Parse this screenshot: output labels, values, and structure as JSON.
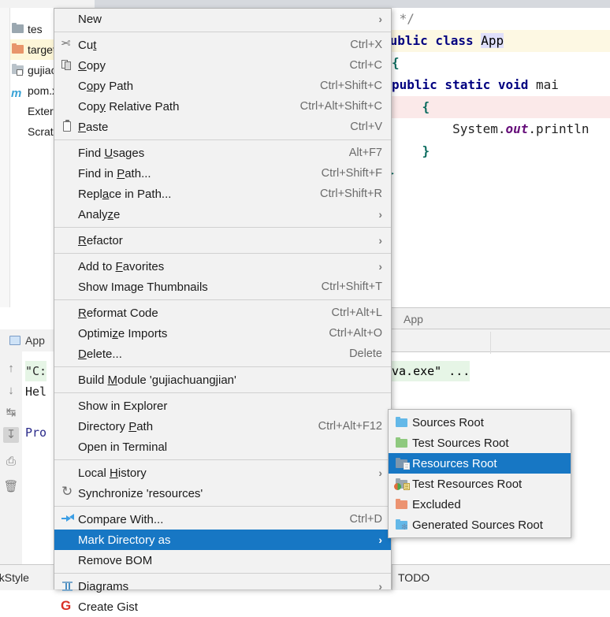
{
  "ide": {
    "project_tree": [
      {
        "label": "tes",
        "icon": "folder-icon",
        "color": "#9aa7b0",
        "twisty": "›",
        "highlight": false
      },
      {
        "label": "target",
        "icon": "folder-excluded-icon",
        "color": "#e8956a",
        "twisty": "",
        "highlight": true
      },
      {
        "label": "gujiac",
        "icon": "module-icon",
        "color": "#b9c2c9",
        "twisty": "",
        "highlight": false
      },
      {
        "label": "pom.x",
        "icon": "maven-icon",
        "color": "#3aa3d6",
        "twisty": "",
        "highlight": false
      },
      {
        "label": "External L",
        "icon": "library-icon",
        "color": "",
        "twisty": "",
        "highlight": false
      },
      {
        "label": "Scratches",
        "icon": "scratches-icon",
        "color": "",
        "twisty": "",
        "highlight": false
      }
    ],
    "editor": {
      "lines": [
        {
          "text": "*/",
          "cls": "cm"
        },
        {
          "text": "public class App",
          "cls": "code"
        },
        {
          "text": "{",
          "cls": "code"
        },
        {
          "text": "    public static void mai",
          "cls": "code"
        },
        {
          "text": "    {",
          "cls": "code"
        },
        {
          "text": "        System.out.println",
          "cls": "code"
        },
        {
          "text": "    }",
          "cls": "code"
        },
        {
          "text": "}",
          "cls": "code"
        }
      ],
      "breadcrumb": "App"
    },
    "run_panel": {
      "tab_label": "App",
      "lines": [
        "\"C:",
        "Hel",
        "",
        "Pro"
      ],
      "lines_right": "va.exe\" ..."
    },
    "status_bar": {
      "left": "eckStyle",
      "right": "TODO"
    }
  },
  "context_menu": {
    "items": [
      {
        "label": "New",
        "mnemonic": "",
        "shortcut": "",
        "arrow": true,
        "icon": "",
        "sep_after": true,
        "selected": false
      },
      {
        "label": "Cut",
        "mnemonic": "t",
        "shortcut": "Ctrl+X",
        "arrow": false,
        "icon": "scissors-icon",
        "sep_after": false,
        "selected": false
      },
      {
        "label": "Copy",
        "mnemonic": "C",
        "shortcut": "Ctrl+C",
        "arrow": false,
        "icon": "copy-icon",
        "sep_after": false,
        "selected": false
      },
      {
        "label": "Copy Path",
        "mnemonic": "o",
        "shortcut": "Ctrl+Shift+C",
        "arrow": false,
        "icon": "",
        "sep_after": false,
        "selected": false
      },
      {
        "label": "Copy Relative Path",
        "mnemonic": "y",
        "shortcut": "Ctrl+Alt+Shift+C",
        "arrow": false,
        "icon": "",
        "sep_after": false,
        "selected": false
      },
      {
        "label": "Paste",
        "mnemonic": "P",
        "shortcut": "Ctrl+V",
        "arrow": false,
        "icon": "paste-icon",
        "sep_after": true,
        "selected": false
      },
      {
        "label": "Find Usages",
        "mnemonic": "U",
        "shortcut": "Alt+F7",
        "arrow": false,
        "icon": "",
        "sep_after": false,
        "selected": false
      },
      {
        "label": "Find in Path...",
        "mnemonic": "P",
        "shortcut": "Ctrl+Shift+F",
        "arrow": false,
        "icon": "",
        "sep_after": false,
        "selected": false
      },
      {
        "label": "Replace in Path...",
        "mnemonic": "a",
        "shortcut": "Ctrl+Shift+R",
        "arrow": false,
        "icon": "",
        "sep_after": false,
        "selected": false
      },
      {
        "label": "Analyze",
        "mnemonic": "z",
        "shortcut": "",
        "arrow": true,
        "icon": "",
        "sep_after": true,
        "selected": false
      },
      {
        "label": "Refactor",
        "mnemonic": "R",
        "shortcut": "",
        "arrow": true,
        "icon": "",
        "sep_after": true,
        "selected": false
      },
      {
        "label": "Add to Favorites",
        "mnemonic": "F",
        "shortcut": "",
        "arrow": true,
        "icon": "",
        "sep_after": false,
        "selected": false
      },
      {
        "label": "Show Image Thumbnails",
        "mnemonic": "",
        "shortcut": "Ctrl+Shift+T",
        "arrow": false,
        "icon": "",
        "sep_after": true,
        "selected": false
      },
      {
        "label": "Reformat Code",
        "mnemonic": "R",
        "shortcut": "Ctrl+Alt+L",
        "arrow": false,
        "icon": "",
        "sep_after": false,
        "selected": false
      },
      {
        "label": "Optimize Imports",
        "mnemonic": "z",
        "shortcut": "Ctrl+Alt+O",
        "arrow": false,
        "icon": "",
        "sep_after": false,
        "selected": false
      },
      {
        "label": "Delete...",
        "mnemonic": "D",
        "shortcut": "Delete",
        "arrow": false,
        "icon": "",
        "sep_after": true,
        "selected": false
      },
      {
        "label": "Build Module 'gujiachuangjian'",
        "mnemonic": "M",
        "shortcut": "",
        "arrow": false,
        "icon": "",
        "sep_after": true,
        "selected": false
      },
      {
        "label": "Show in Explorer",
        "mnemonic": "",
        "shortcut": "",
        "arrow": false,
        "icon": "",
        "sep_after": false,
        "selected": false
      },
      {
        "label": "Directory Path",
        "mnemonic": "P",
        "shortcut": "Ctrl+Alt+F12",
        "arrow": false,
        "icon": "",
        "sep_after": false,
        "selected": false
      },
      {
        "label": "Open in Terminal",
        "mnemonic": "",
        "shortcut": "",
        "arrow": false,
        "icon": "terminal-icon",
        "sep_after": true,
        "selected": false
      },
      {
        "label": "Local History",
        "mnemonic": "H",
        "shortcut": "",
        "arrow": true,
        "icon": "",
        "sep_after": false,
        "selected": false
      },
      {
        "label": "Synchronize 'resources'",
        "mnemonic": "",
        "shortcut": "",
        "arrow": false,
        "icon": "sync-icon",
        "sep_after": true,
        "selected": false
      },
      {
        "label": "Compare With...",
        "mnemonic": "",
        "shortcut": "Ctrl+D",
        "arrow": false,
        "icon": "compare-icon",
        "sep_after": false,
        "selected": false
      },
      {
        "label": "Mark Directory as",
        "mnemonic": "",
        "shortcut": "",
        "arrow": true,
        "icon": "",
        "sep_after": false,
        "selected": true
      },
      {
        "label": "Remove BOM",
        "mnemonic": "",
        "shortcut": "",
        "arrow": false,
        "icon": "",
        "sep_after": true,
        "selected": false
      },
      {
        "label": "Diagrams",
        "mnemonic": "",
        "shortcut": "",
        "arrow": true,
        "icon": "diagram-icon",
        "sep_after": false,
        "selected": false
      },
      {
        "label": "Create Gist",
        "mnemonic": "",
        "shortcut": "",
        "arrow": false,
        "icon": "gist-icon",
        "sep_after": false,
        "selected": false
      }
    ]
  },
  "submenu": {
    "title": "Mark Directory as",
    "items": [
      {
        "label": "Sources Root",
        "icon": "folder-sources-icon",
        "color": "#63b8e8",
        "badge": false,
        "dot": false,
        "gear": false,
        "selected": false
      },
      {
        "label": "Test Sources Root",
        "icon": "folder-test-sources-icon",
        "color": "#8fc97f",
        "badge": false,
        "dot": false,
        "gear": false,
        "selected": false
      },
      {
        "label": "Resources Root",
        "icon": "folder-resources-icon",
        "color": "#7e97ad",
        "badge": true,
        "dot": false,
        "gear": false,
        "selected": true
      },
      {
        "label": "Test Resources Root",
        "icon": "folder-test-resources-icon",
        "color": "#9aa7b0",
        "badge": true,
        "dot": true,
        "gear": false,
        "selected": false
      },
      {
        "label": "Excluded",
        "icon": "folder-excluded-icon",
        "color": "#ec9371",
        "badge": false,
        "dot": false,
        "gear": false,
        "selected": false
      },
      {
        "label": "Generated Sources Root",
        "icon": "folder-generated-sources-icon",
        "color": "#63b8e8",
        "badge": false,
        "dot": false,
        "gear": true,
        "selected": false
      }
    ],
    "accent": "#1777c4"
  }
}
